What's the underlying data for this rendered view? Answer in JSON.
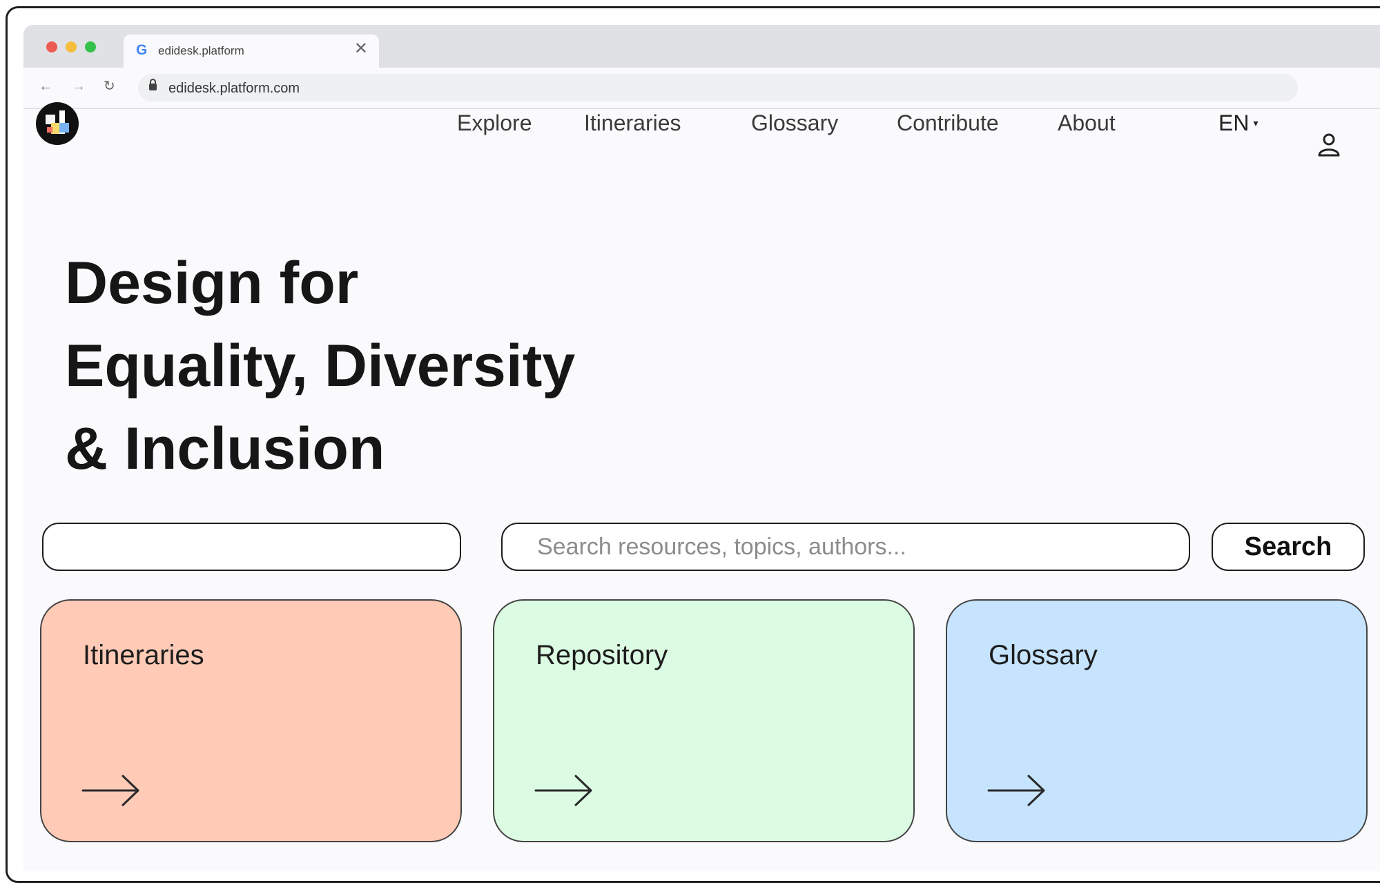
{
  "browser": {
    "tab_title": "edidesk.platform",
    "tab_close": "✕",
    "url": "edidesk.platform.com"
  },
  "nav": {
    "items": [
      "Explore",
      "Itineraries",
      "Glossary",
      "Contribute",
      "About"
    ],
    "language": "EN",
    "language_caret": "▾"
  },
  "hero": {
    "lines": [
      "Design for",
      "Equality, Diversity",
      "& Inclusion"
    ]
  },
  "search": {
    "filter_value": "",
    "placeholder": "Search resources, topics, authors...",
    "button_label": "Search"
  },
  "cards": [
    {
      "title": "Itineraries",
      "color": "#ffcbb7"
    },
    {
      "title": "Repository",
      "color": "#dcfbe3"
    },
    {
      "title": "Glossary",
      "color": "#c6e4fd"
    }
  ],
  "icons": {
    "back": "back-arrow-icon",
    "forward": "forward-arrow-icon",
    "reload": "reload-icon",
    "lock": "lock-icon",
    "user": "user-icon",
    "card_arrow": "right-arrow-icon"
  }
}
